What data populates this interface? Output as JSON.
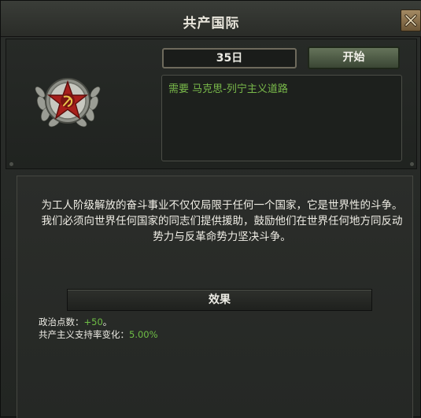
{
  "window": {
    "title": "共产国际"
  },
  "decision": {
    "duration": "35日",
    "start_label": "开始",
    "requirement": "需要 马克思-列宁主义道路",
    "description": "为工人阶级解放的奋斗事业不仅仅局限于任何一个国家，它是世界性的斗争。我们必须向世界任何国家的同志们提供援助，鼓励他们在世界任何地方同反动势力与反革命势力坚决斗争。"
  },
  "effects": {
    "header": "效果",
    "items": [
      {
        "label": "政治点数：",
        "value": "+50",
        "suffix": "。"
      },
      {
        "label": "共产主义支持率变化：",
        "value": "5.00%",
        "suffix": ""
      }
    ]
  },
  "icons": {
    "close": "close-icon",
    "emblem": "communist-star-emblem-icon"
  },
  "colors": {
    "requirement_text": "#79b94a",
    "effect_value": "#6fbf46",
    "start_button": "#56654c",
    "close_button": "#8c734e"
  }
}
